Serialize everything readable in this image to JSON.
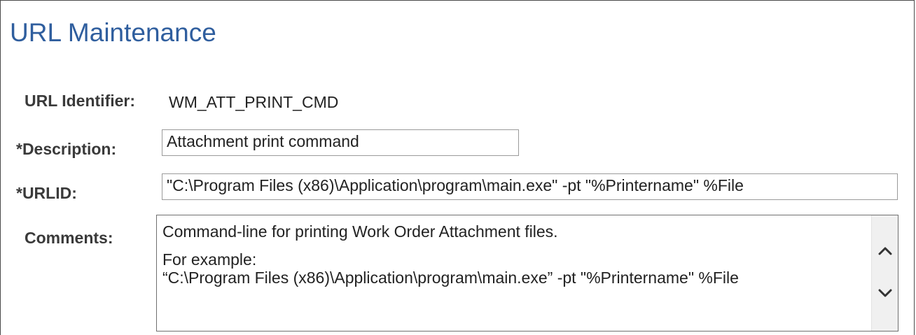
{
  "page": {
    "title": "URL Maintenance"
  },
  "form": {
    "url_identifier_label": "URL Identifier:",
    "url_identifier_value": "WM_ATT_PRINT_CMD",
    "description_label": "*Description:",
    "description_value": "Attachment print command",
    "urlid_label": "*URLID:",
    "urlid_value": "\"C:\\Program Files (x86)\\Application\\program\\main.exe\" -pt \"%Printername\" %File",
    "comments_label": "Comments:",
    "comments_lines": [
      "Command-line for printing Work Order Attachment files.",
      "For example:",
      "“C:\\Program Files (x86)\\Application\\program\\main.exe” -pt \"%Printername\" %File"
    ]
  },
  "icons": {
    "scroll_up": "chevron-up-icon",
    "scroll_down": "chevron-down-icon"
  },
  "colors": {
    "title": "#2f5e9e",
    "label": "#3a3a3a",
    "text": "#222222",
    "input_border": "#9a9a9a",
    "scrollbar_bg": "#f0f0f0"
  }
}
